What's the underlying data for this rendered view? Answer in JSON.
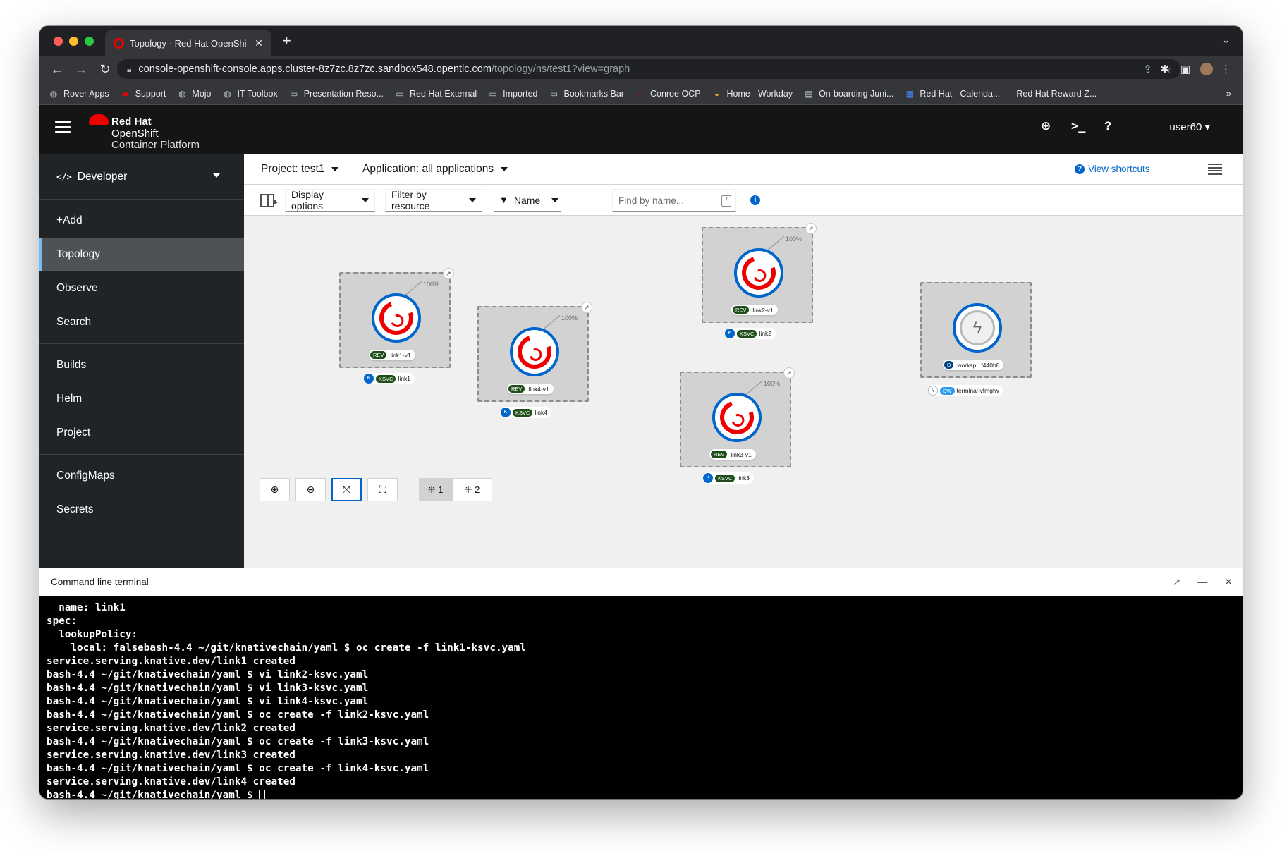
{
  "browser": {
    "tab_title": "Topology · Red Hat OpenShift Co",
    "url_host": "console-openshift-console.apps.cluster-8z7zc.8z7zc.sandbox548.opentlc.com",
    "url_path": "/topology/ns/test1?view=graph",
    "bookmarks": [
      {
        "icon": "globe-icon",
        "label": "Rover Apps"
      },
      {
        "icon": "now-icon",
        "label": "Support"
      },
      {
        "icon": "globe-icon",
        "label": "Mojo"
      },
      {
        "icon": "globe-icon",
        "label": "IT Toolbox"
      },
      {
        "icon": "folder-icon",
        "label": "Presentation Reso..."
      },
      {
        "icon": "folder-icon",
        "label": "Red Hat External"
      },
      {
        "icon": "folder-icon",
        "label": "Imported"
      },
      {
        "icon": "folder-icon",
        "label": "Bookmarks Bar"
      },
      {
        "icon": "openshift-icon",
        "label": "Conroe OCP"
      },
      {
        "icon": "workday-icon",
        "label": "Home - Workday"
      },
      {
        "icon": "page-icon",
        "label": "On-boarding Juni..."
      },
      {
        "icon": "calendar-icon",
        "label": "Red Hat - Calenda..."
      },
      {
        "icon": "",
        "label": "Red Hat Reward Z..."
      }
    ]
  },
  "masthead": {
    "brand_line1": "Red Hat",
    "brand_line2": "OpenShift",
    "brand_line3": "Container Platform",
    "user": "user60"
  },
  "sidebar": {
    "perspective": "Developer",
    "groups": [
      [
        {
          "label": "+Add"
        },
        {
          "label": "Topology",
          "active": true
        },
        {
          "label": "Observe"
        },
        {
          "label": "Search"
        }
      ],
      [
        {
          "label": "Builds"
        },
        {
          "label": "Helm"
        },
        {
          "label": "Project"
        }
      ],
      [
        {
          "label": "ConfigMaps"
        },
        {
          "label": "Secrets"
        }
      ]
    ]
  },
  "context": {
    "project": "Project: test1",
    "application": "Application: all applications",
    "shortcuts": "View shortcuts"
  },
  "toolbar": {
    "display_options": "Display options",
    "filter_by_resource": "Filter by resource",
    "name_filter": "Name",
    "find_placeholder": "Find by name...",
    "slash": "/"
  },
  "topology": {
    "nodes": [
      {
        "id": "link1",
        "rev_badge": "REV",
        "rev": "link1-v1",
        "ksvc_badge": "KSVC",
        "ksvc": "link1",
        "traffic": "100%"
      },
      {
        "id": "link4",
        "rev_badge": "REV",
        "rev": "link4-v1",
        "ksvc_badge": "KSVC",
        "ksvc": "link4",
        "traffic": "100%"
      },
      {
        "id": "link2",
        "rev_badge": "REV",
        "rev": "link2-v1",
        "ksvc_badge": "KSVC",
        "ksvc": "link2",
        "traffic": "100%"
      },
      {
        "id": "link3",
        "rev_badge": "REV",
        "rev": "link3-v1",
        "ksvc_badge": "KSVC",
        "ksvc": "link3",
        "traffic": "100%"
      }
    ],
    "workspace": {
      "d_badge": "D",
      "name": "worksp...f440b8",
      "dw_badge": "DW",
      "dw_name": "terminal-vfmgtw"
    },
    "layout1": "1",
    "layout2": "2"
  },
  "terminal": {
    "title": "Command line terminal",
    "lines": [
      "  name: link1",
      "spec:",
      "  lookupPolicy:",
      "    local: falsebash-4.4 ~/git/knativechain/yaml $ oc create -f link1-ksvc.yaml",
      "service.serving.knative.dev/link1 created",
      "bash-4.4 ~/git/knativechain/yaml $ vi link2-ksvc.yaml",
      "bash-4.4 ~/git/knativechain/yaml $ vi link3-ksvc.yaml",
      "bash-4.4 ~/git/knativechain/yaml $ vi link4-ksvc.yaml",
      "bash-4.4 ~/git/knativechain/yaml $ oc create -f link2-ksvc.yaml",
      "service.serving.knative.dev/link2 created",
      "bash-4.4 ~/git/knativechain/yaml $ oc create -f link3-ksvc.yaml",
      "service.serving.knative.dev/link3 created",
      "bash-4.4 ~/git/knativechain/yaml $ oc create -f link4-ksvc.yaml",
      "service.serving.knative.dev/link4 created",
      "bash-4.4 ~/git/knativechain/yaml $ "
    ]
  },
  "colors": {
    "accent": "#0066cc",
    "openshift_red": "#ee0000",
    "active_nav": "#4f5255"
  }
}
